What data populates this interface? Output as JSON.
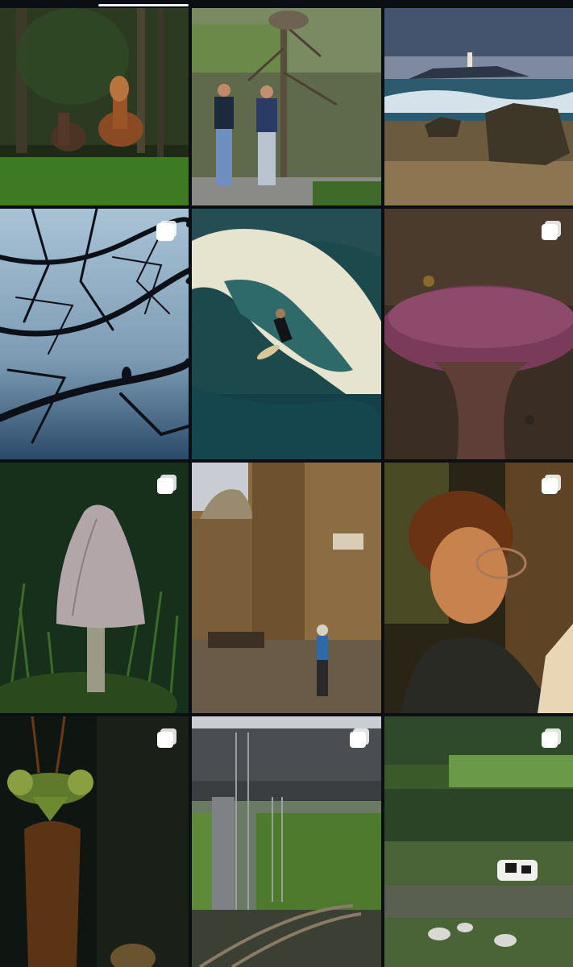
{
  "profile_tabs": {
    "active_index": 1,
    "count": 3
  },
  "colors": {
    "background": "#0b0f14",
    "indicator": "#f2f2f2",
    "badge": "#ffffff"
  },
  "posts": [
    {
      "id": "post-1",
      "subject": "horses-in-forest",
      "multi": false
    },
    {
      "id": "post-2",
      "subject": "two-men-by-tree",
      "multi": false
    },
    {
      "id": "post-3",
      "subject": "lighthouse-island-seascape",
      "multi": false
    },
    {
      "id": "post-4",
      "subject": "bird-on-branches-silhouette",
      "multi": true
    },
    {
      "id": "post-5",
      "subject": "surfer-wave",
      "multi": false
    },
    {
      "id": "post-6",
      "subject": "fly-on-mushroom",
      "multi": true
    },
    {
      "id": "post-7",
      "subject": "shaggy-mane-mushroom",
      "multi": true
    },
    {
      "id": "post-8",
      "subject": "old-town-street",
      "multi": false
    },
    {
      "id": "post-9",
      "subject": "young-man-glasses",
      "multi": true
    },
    {
      "id": "post-10",
      "subject": "praying-mantis",
      "multi": true
    },
    {
      "id": "post-11",
      "subject": "railway-bridge",
      "multi": true
    },
    {
      "id": "post-12",
      "subject": "cow-and-egrets-field",
      "multi": true
    }
  ],
  "icons": {
    "multi_badge": "carousel-icon"
  }
}
